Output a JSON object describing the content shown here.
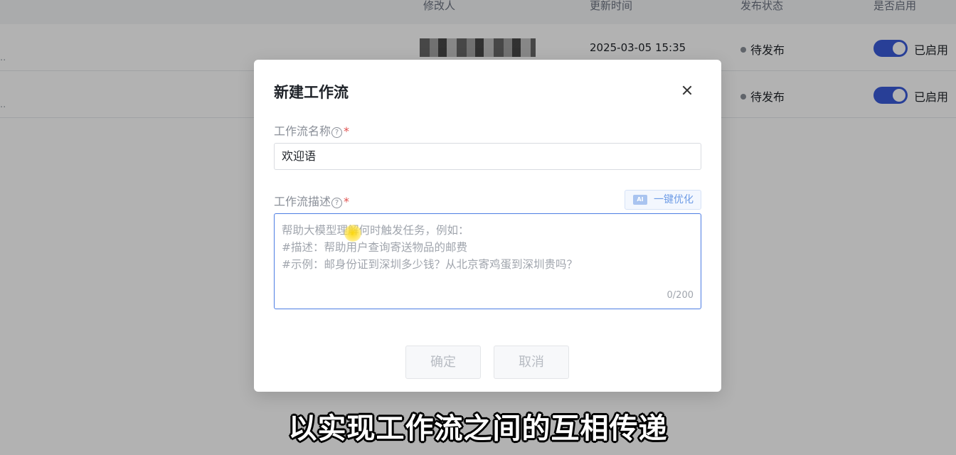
{
  "table": {
    "headers": [
      "修改人",
      "更新时间",
      "发布状态",
      "是否启用"
    ],
    "rows": [
      {
        "name_suffix": "..",
        "time": "2025-03-05 15:35",
        "status": "待发布",
        "enabled_label": "已启用",
        "enabled": true
      },
      {
        "name_suffix": "..",
        "time": "",
        "status": "待发布",
        "enabled_label": "已启用",
        "enabled": true
      }
    ]
  },
  "modal": {
    "title": "新建工作流",
    "name_field": {
      "label": "工作流名称",
      "help": "?",
      "required_mark": "*",
      "value": "欢迎语"
    },
    "desc_field": {
      "label": "工作流描述",
      "help": "?",
      "required_mark": "*",
      "ai_button": "一键优化",
      "ai_icon_text": "AI",
      "placeholder_lines": [
        "帮助大模型理解何时触发任务，例如：",
        "#描述：帮助用户查询寄送物品的邮费",
        "#示例：邮身份证到深圳多少钱？从北京寄鸡蛋到深圳贵吗？"
      ],
      "counter": "0/200"
    },
    "buttons": {
      "ok": "确定",
      "cancel": "取消"
    }
  },
  "subtitle": "以实现工作流之间的互相传递",
  "colors": {
    "accent": "#3a5bd9",
    "focus_border": "#4d7de3",
    "required": "#e0524f"
  }
}
